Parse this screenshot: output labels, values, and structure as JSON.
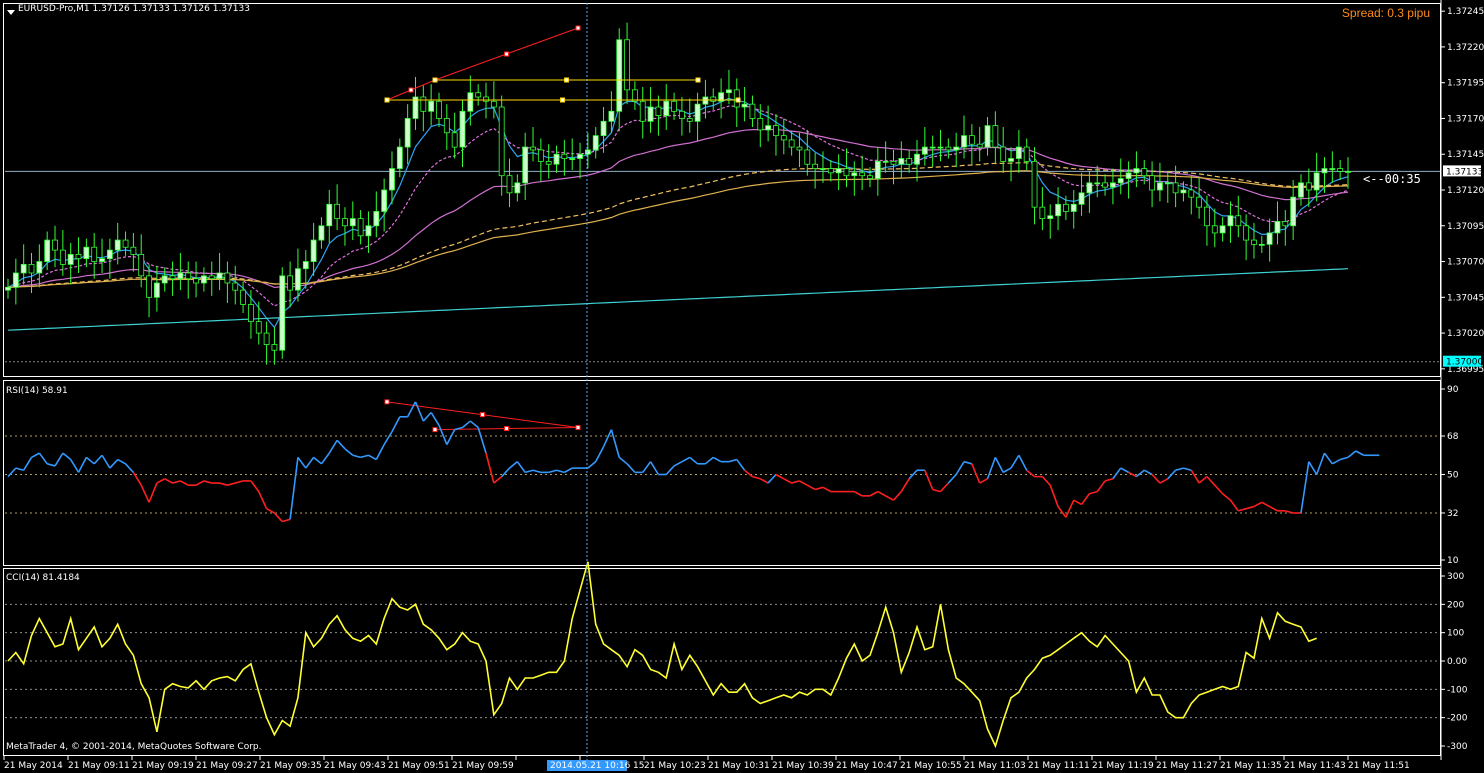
{
  "window": {
    "title": "EURUSD-Pro,M1  1.37126 1.37133 1.37126 1.37133",
    "spread": "Spread: 0.3 pipu",
    "countdown": "<--00:35",
    "copyright": "MetaTrader 4, © 2001-2014, MetaQuotes Software Corp."
  },
  "colors": {
    "background": "#000000",
    "grid": "#808080",
    "bull_candle": "#ccffcc",
    "bear_candle": "#000000",
    "candle_outline": "#33ff33",
    "ma_fast": "#2ea3f2",
    "ma_dashed_pink": "#e070e0",
    "ma_pink": "#d070d0",
    "ma_dashed_gold": "#f0c060",
    "ma_gold": "#e0b050",
    "ma_teal": "#40d0d0",
    "trend_red": "#ff2020",
    "trend_yellow": "#ffd700",
    "rsi_up": "#3399ff",
    "rsi_down": "#ff2020",
    "cci": "#ffff33",
    "bid_label_bg": "#ffffff",
    "level_label_bg": "#00ffff",
    "selected_time_bg": "#3399ff"
  },
  "price_axis": {
    "ticks": [
      "1.37245",
      "1.37220",
      "1.37195",
      "1.37170",
      "1.37145",
      "1.37120",
      "1.37095",
      "1.37070",
      "1.37045",
      "1.37020",
      "1.36995"
    ],
    "current_price": "1.37133",
    "level_price": "1.37000"
  },
  "rsi": {
    "title": "RSI(14) 58.91",
    "ticks": [
      "90",
      "68",
      "50",
      "32",
      "10"
    ]
  },
  "cci": {
    "title": "CCI(14) 81.4184",
    "ticks": [
      "300",
      "200",
      "100",
      "0.00",
      "-100",
      "-200",
      "-300"
    ]
  },
  "time_axis": {
    "labels": [
      "21 May 2014",
      "21 May 09:11",
      "21 May 09:19",
      "21 May 09:27",
      "21 May 09:35",
      "21 May 09:43",
      "21 May 09:51",
      "21 May 09:59",
      "",
      "15",
      "21 May 10:23",
      "21 May 10:31",
      "21 May 10:39",
      "21 May 10:47",
      "21 May 10:55",
      "21 May 11:03",
      "21 May 11:11",
      "21 May 11:19",
      "21 May 11:27",
      "21 May 11:35",
      "21 May 11:43",
      "21 May 11:51"
    ],
    "selected_time": "2014.05.21 10:16"
  },
  "chart_data": {
    "type": "candlestick",
    "price_range": [
      1.3699,
      1.3725
    ],
    "close": [
      1.37052,
      1.37062,
      1.37068,
      1.37062,
      1.3707,
      1.37085,
      1.37078,
      1.37068,
      1.37075,
      1.37072,
      1.3708,
      1.3707,
      1.37072,
      1.37078,
      1.37085,
      1.3708,
      1.37075,
      1.3706,
      1.37045,
      1.37055,
      1.3706,
      1.37058,
      1.37062,
      1.37058,
      1.37055,
      1.3706,
      1.37058,
      1.37062,
      1.37055,
      1.3705,
      1.3704,
      1.37028,
      1.3702,
      1.37012,
      1.37008,
      1.3706,
      1.3705,
      1.37065,
      1.3707,
      1.37085,
      1.37095,
      1.3711,
      1.371,
      1.37095,
      1.371,
      1.37088,
      1.37095,
      1.37105,
      1.3712,
      1.37135,
      1.3715,
      1.3717,
      1.37185,
      1.37175,
      1.37182,
      1.3717,
      1.3716,
      1.3715,
      1.37175,
      1.37188,
      1.37185,
      1.37182,
      1.37178,
      1.3713,
      1.37118,
      1.37125,
      1.3715,
      1.37148,
      1.3714,
      1.37138,
      1.37145,
      1.37142,
      1.37142,
      1.37145,
      1.37148,
      1.37158,
      1.37168,
      1.37175,
      1.37225,
      1.3719,
      1.37182,
      1.37168,
      1.37178,
      1.37172,
      1.37182,
      1.37175,
      1.3717,
      1.37168,
      1.3718,
      1.37185,
      1.37182,
      1.37188,
      1.3719,
      1.37178,
      1.3718,
      1.3717,
      1.37162,
      1.37165,
      1.37158,
      1.37155,
      1.3715,
      1.37148,
      1.37138,
      1.37135,
      1.37135,
      1.37132,
      1.37135,
      1.3713,
      1.37132,
      1.3713,
      1.37128,
      1.3714,
      1.3714,
      1.37138,
      1.37142,
      1.37138,
      1.37145,
      1.3715,
      1.3715,
      1.3715,
      1.37148,
      1.3715,
      1.37158,
      1.37152,
      1.3715,
      1.37165,
      1.3715,
      1.3714,
      1.37142,
      1.3715,
      1.3714,
      1.37108,
      1.371,
      1.37102,
      1.3711,
      1.37105,
      1.3711,
      1.37118,
      1.37125,
      1.37125,
      1.37122,
      1.37125,
      1.37128,
      1.37132,
      1.37135,
      1.3713,
      1.3712,
      1.37125,
      1.37125,
      1.37118,
      1.3712,
      1.37115,
      1.37108,
      1.37095,
      1.3709,
      1.37095,
      1.37102,
      1.37095,
      1.37085,
      1.37082,
      1.37082,
      1.3709,
      1.37098,
      1.37095,
      1.37115,
      1.37125,
      1.3712,
      1.37132,
      1.37135,
      1.37135,
      1.37133,
      1.37133
    ],
    "rsi": [
      49,
      53,
      52,
      58,
      60,
      55,
      54,
      60,
      57,
      51,
      58,
      55,
      59,
      53,
      57,
      55,
      51,
      45,
      37,
      46,
      48,
      46,
      47,
      45,
      45,
      47,
      46,
      46,
      45,
      46,
      47,
      47,
      42,
      34,
      32,
      28,
      29,
      58,
      53,
      58,
      55,
      60,
      66,
      62,
      59,
      58,
      59,
      57,
      64,
      70,
      77,
      77,
      84,
      75,
      79,
      73,
      64,
      71,
      72,
      75,
      72,
      60,
      46,
      49,
      53,
      56,
      51,
      52,
      51,
      51,
      52,
      51,
      53,
      53,
      53,
      56,
      63,
      71,
      58,
      55,
      51,
      51,
      56,
      50,
      50,
      54,
      56,
      58,
      55,
      55,
      58,
      56,
      56,
      57,
      52,
      49,
      48,
      46,
      50,
      48,
      46,
      47,
      45,
      43,
      44,
      42,
      42,
      42,
      42,
      40,
      40,
      42,
      40,
      38,
      42,
      48,
      52,
      52,
      43,
      42,
      46,
      50,
      56,
      55,
      46,
      48,
      58,
      51,
      53,
      59,
      52,
      49,
      49,
      45,
      35,
      30,
      38,
      36,
      41,
      42,
      47,
      48,
      53,
      51,
      49,
      52,
      50,
      46,
      48,
      52,
      53,
      52,
      46,
      49,
      45,
      41,
      38,
      33,
      34,
      35,
      37,
      35,
      33,
      33,
      32,
      32,
      56,
      50,
      60,
      55,
      57,
      58,
      61,
      59,
      59,
      59
    ],
    "cci": [
      0,
      30,
      -10,
      90,
      150,
      100,
      50,
      60,
      150,
      40,
      80,
      120,
      50,
      80,
      130,
      60,
      20,
      -80,
      -130,
      -250,
      -100,
      -80,
      -90,
      -95,
      -70,
      -100,
      -70,
      -60,
      -55,
      -70,
      -30,
      -10,
      -110,
      -200,
      -260,
      -210,
      -230,
      -130,
      100,
      50,
      80,
      130,
      160,
      110,
      80,
      70,
      90,
      60,
      150,
      220,
      190,
      180,
      200,
      130,
      110,
      80,
      40,
      60,
      100,
      70,
      60,
      0,
      -190,
      -150,
      -60,
      -100,
      -60,
      -60,
      -50,
      -40,
      -40,
      0,
      150,
      250,
      350,
      130,
      60,
      40,
      20,
      -20,
      40,
      20,
      -30,
      -40,
      -60,
      60,
      -30,
      20,
      -20,
      -70,
      -120,
      -80,
      -110,
      -110,
      -80,
      -130,
      -150,
      -140,
      -130,
      -120,
      -130,
      -110,
      -120,
      -100,
      -100,
      -120,
      -60,
      10,
      60,
      0,
      20,
      100,
      190,
      100,
      -40,
      30,
      120,
      40,
      50,
      200,
      40,
      -60,
      -80,
      -110,
      -140,
      -240,
      -300,
      -210,
      -130,
      -110,
      -60,
      -30,
      10,
      20,
      40,
      60,
      80,
      100,
      70,
      50,
      90,
      60,
      30,
      0,
      -110,
      -60,
      -120,
      -120,
      -180,
      -200,
      -200,
      -150,
      -120,
      -110,
      -100,
      -90,
      -100,
      -90,
      30,
      10,
      150,
      80,
      170,
      140,
      130,
      120,
      70,
      80
    ]
  }
}
